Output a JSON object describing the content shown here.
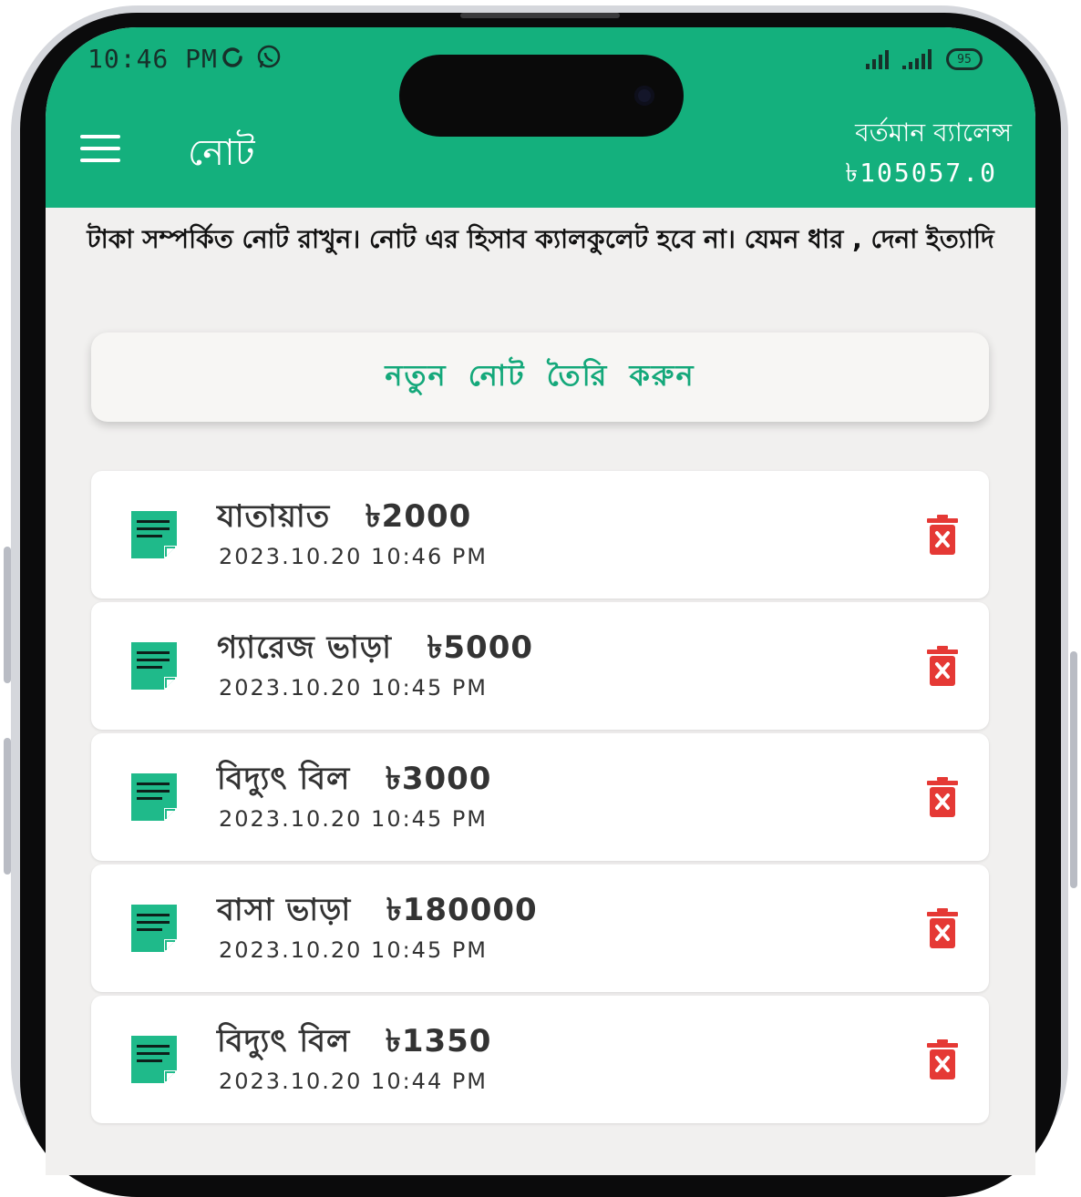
{
  "status_bar": {
    "time": "10:46 PM",
    "battery": "95"
  },
  "appbar": {
    "title": "নোট",
    "balance_label": "বর্তমান ব্যালেন্স",
    "balance_value": "৳105057.0"
  },
  "description": "টাকা সম্পর্কিত নোট রাখুন। নোট এর হিসাব ক্যালকুলেট হবে না। যেমন ধার , দেনা ইত্যাদি",
  "new_note_button": "নতুন নোট তৈরি করুন",
  "colors": {
    "primary": "#14b07d",
    "delete": "#e53935",
    "icon": "#1fba8a"
  },
  "notes": [
    {
      "title": "যাতায়াত",
      "amount": "৳2000",
      "date": "2023.10.20 10:46 PM"
    },
    {
      "title": "গ্যারেজ ভাড়া",
      "amount": "৳5000",
      "date": "2023.10.20 10:45 PM"
    },
    {
      "title": "বিদ্যুৎ বিল",
      "amount": "৳3000",
      "date": "2023.10.20 10:45 PM"
    },
    {
      "title": "বাসা ভাড়া",
      "amount": "৳180000",
      "date": "2023.10.20 10:45 PM"
    },
    {
      "title": "বিদ্যুৎ বিল",
      "amount": "৳1350",
      "date": "2023.10.20 10:44 PM"
    }
  ]
}
